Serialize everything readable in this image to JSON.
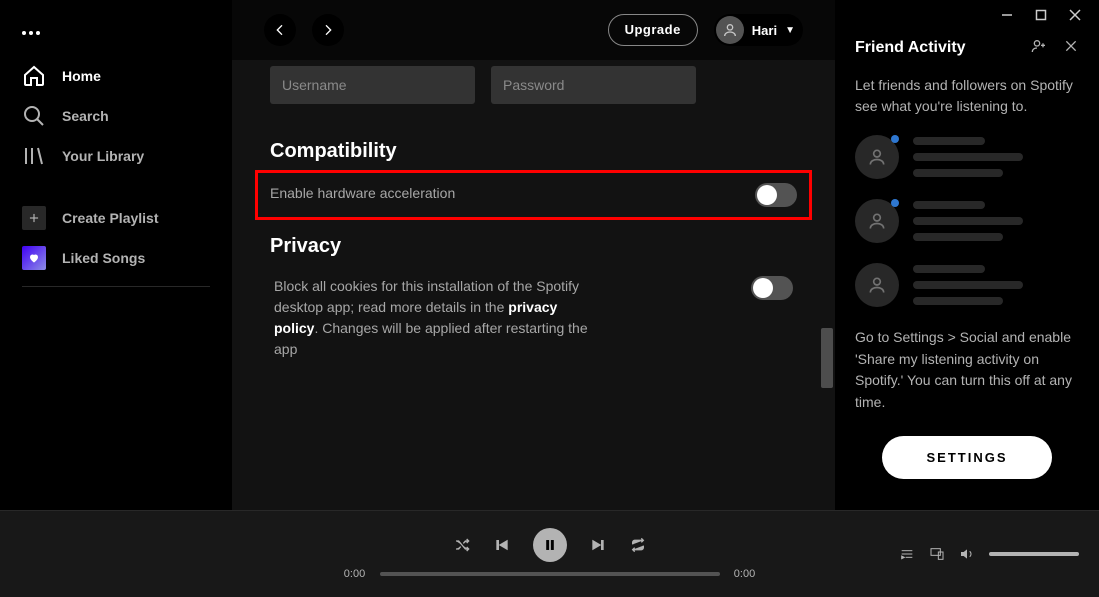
{
  "titlebar": {},
  "sidebar": {
    "nav": [
      {
        "label": "Home"
      },
      {
        "label": "Search"
      },
      {
        "label": "Your Library"
      }
    ],
    "library": [
      {
        "label": "Create Playlist"
      },
      {
        "label": "Liked Songs"
      }
    ]
  },
  "topbar": {
    "upgrade_label": "Upgrade",
    "user_name": "Hari"
  },
  "settings": {
    "username_placeholder": "Username",
    "password_placeholder": "Password",
    "compatibility": {
      "title": "Compatibility",
      "hw_accel_label": "Enable hardware acceleration",
      "hw_accel_on": false
    },
    "privacy": {
      "title": "Privacy",
      "text_before": "Block all cookies for this installation of the Spotify desktop app; read more details in the ",
      "link_text": "privacy policy",
      "text_after": ". Changes will be applied after restarting the app",
      "block_cookies_on": false
    }
  },
  "friends": {
    "title": "Friend Activity",
    "intro": "Let friends and followers on Spotify see what you're listening to.",
    "help": "Go to Settings > Social and enable 'Share my listening activity on Spotify.' You can turn this off at any time.",
    "settings_label": "SETTINGS"
  },
  "player": {
    "elapsed": "0:00",
    "duration": "0:00"
  }
}
